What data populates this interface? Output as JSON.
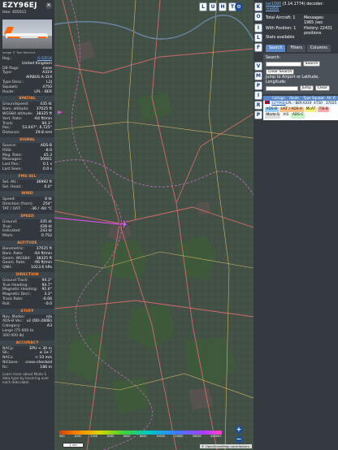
{
  "info_panel": {
    "callsign": "EZY96EJ",
    "hex_label": "Hex:",
    "hex": "405011",
    "close_icon": "close-icon",
    "photo_credit": "Image © Tom Reichert",
    "summary": [
      {
        "k": "Reg.:",
        "v": "G-EZGX",
        "link": true
      },
      {
        "k": "",
        "v": "United Kingdom"
      },
      {
        "k": "DB flags:",
        "v": "none"
      },
      {
        "k": "Type:",
        "v": "A319"
      },
      {
        "k": "",
        "v": "AIRBUS A-319"
      },
      {
        "k": "",
        "v": ""
      },
      {
        "k": "Type Desc.:",
        "v": "L2J"
      },
      {
        "k": "Squawk:",
        "v": "4750"
      },
      {
        "k": "Route:",
        "v": "LPL - BER"
      }
    ],
    "sections": [
      {
        "title": "SPATIAL",
        "rows": [
          {
            "k": "Groundspeed:",
            "v": "435 kt"
          },
          {
            "k": "Baro. altitude:",
            "v": "37025 ft"
          },
          {
            "k": "WGS84 altitude:",
            "v": "38325 ft"
          },
          {
            "k": "Vert. Rate:",
            "v": "-64 ft/min"
          },
          {
            "k": "Track:",
            "v": "94.3°"
          },
          {
            "k": "Pos.:",
            "v": "53.047°, 6.725°"
          },
          {
            "k": "Distance:",
            "v": "29.8 nmi"
          }
        ]
      },
      {
        "title": "SIGNAL",
        "rows": [
          {
            "k": "Source:",
            "v": "ADS-B"
          },
          {
            "k": "RSSI:",
            "v": "-8.0"
          },
          {
            "k": "Msg. Rate:",
            "v": "45.3"
          },
          {
            "k": "Messages:",
            "v": "50661"
          },
          {
            "k": "",
            "v": ""
          },
          {
            "k": "Last Pos.:",
            "v": "0.1 s"
          },
          {
            "k": "Last Seen:",
            "v": "0.0 s"
          }
        ]
      },
      {
        "title": "FMS SEL",
        "rows": [
          {
            "k": "Sel. Alt.:",
            "v": "36992 ft"
          },
          {
            "k": "Sel. Head.:",
            "v": "0.0°"
          }
        ]
      },
      {
        "title": "WIND",
        "rows": [
          {
            "k": "Speed:",
            "v": "8 kt"
          },
          {
            "k": "Direction (from):",
            "v": "254°"
          },
          {
            "k": "TAT / OAT:",
            "v": "-36 / -60 °C"
          }
        ]
      },
      {
        "title": "SPEED",
        "rows": [
          {
            "k": "Ground:",
            "v": "435 kt"
          },
          {
            "k": "True:",
            "v": "428 kt"
          },
          {
            "k": "Indicated:",
            "v": "243 kt"
          },
          {
            "k": "Mach:",
            "v": "0.752"
          }
        ]
      },
      {
        "title": "ALTITUDE",
        "rows": [
          {
            "k": "Barometric:",
            "v": "37025 ft"
          },
          {
            "k": "Baro. Rate:",
            "v": "-64 ft/min"
          },
          {
            "k": "Geom. WGS84:",
            "v": "38325 ft"
          },
          {
            "k": "Geom. Rate:",
            "v": "-96 ft/min"
          },
          {
            "k": "QNH:",
            "v": "1013.6 hPa"
          }
        ]
      },
      {
        "title": "DIRECTION",
        "rows": [
          {
            "k": "Ground Track:",
            "v": "94.3°"
          },
          {
            "k": "True Heading:",
            "v": "94.7°"
          },
          {
            "k": "Magnetic Heading:",
            "v": "91.6°"
          },
          {
            "k": "Magnetic Decl.:",
            "v": "3.3°"
          },
          {
            "k": "Track Rate:",
            "v": "-0.06"
          },
          {
            "k": "Roll:",
            "v": "-0.0"
          }
        ]
      },
      {
        "title": "STUFF",
        "rows": [
          {
            "k": "Nav. Modes:",
            "v": "n/a"
          },
          {
            "k": "ADS-B Ver.:",
            "v": "v2 (DO-260B)"
          },
          {
            "k": "Category:",
            "v": "A3"
          },
          {
            "k": "Large (75 000 to",
            "v": ""
          },
          {
            "k": "300 000 lb)",
            "v": ""
          }
        ]
      },
      {
        "title": "ACCURACY",
        "rows": [
          {
            "k": "NACp:",
            "v": "EPU < 30 m"
          },
          {
            "k": "SIL:",
            "v": "≤ 1e-7"
          },
          {
            "k": "NACv:",
            "v": "< 10 m/s"
          },
          {
            "k": "NICbaro:",
            "v": "cross-checked"
          },
          {
            "k": "Rc:",
            "v": "186 m"
          }
        ]
      }
    ],
    "footer_note": "Learn more about Mode S data type by hovering over each data label."
  },
  "map": {
    "top_buttons": [
      "L",
      "U",
      "H",
      "T"
    ],
    "zoom_in": "+",
    "zoom_out": "−",
    "attribution": "© OpenStreetMap contributors.",
    "scale_label": "1 nm",
    "altitude_legend": [
      "500",
      "1000",
      "2000",
      "4000",
      "6000",
      "8000",
      "10000",
      "20000",
      "30000",
      "40000+"
    ]
  },
  "right_panel": {
    "side_buttons": [
      "K",
      "O",
      "I",
      "L",
      "F",
      "V",
      "M",
      "P",
      "I",
      "R",
      "P"
    ],
    "version_prefix": "tar1090",
    "version_text": "(3.14.1774) decoder:",
    "version_link": "readsb",
    "stats": {
      "total_label": "Total Aircraft:",
      "total": "1",
      "with_pos_label": "With Position:",
      "with_pos": "1",
      "stats_label": "Stats available",
      "messages_label": "Messages:",
      "messages": "1965 /sec",
      "history_label": "History:",
      "history": "22431 positions"
    },
    "tabs": [
      "Search",
      "Filters",
      "Columns"
    ],
    "search_label": "Search:",
    "search_button": "Search",
    "clear_search_button": "Clear Search",
    "jump_label": "Jump to Airport or Latitude, Longitude:",
    "jump_button": "Jump",
    "clear_button": "Clear",
    "table_headers": [
      "",
      "Callsign",
      "Route",
      "Type",
      "Squawk",
      "Alt. ft"
    ],
    "table_row": {
      "flag": "GB",
      "callsign": "EZY96EJ",
      "route": "LPL - BER",
      "type": "A319",
      "squawk": "4750",
      "alt": "37025"
    },
    "legend": [
      {
        "label": "ADS-B",
        "color": "#9ad3ff"
      },
      {
        "label": "UAT / ADS-R",
        "color": "#ffc08a"
      },
      {
        "label": "MLAT",
        "color": "#f3f17c"
      },
      {
        "label": "TIS-B",
        "color": "#ffaaaa"
      },
      {
        "label": "Mode-S",
        "color": "#dddddd"
      },
      {
        "label": "AIS",
        "color": "#ffffff"
      },
      {
        "label": "ADS-C",
        "color": "#c8f5c8"
      }
    ]
  }
}
